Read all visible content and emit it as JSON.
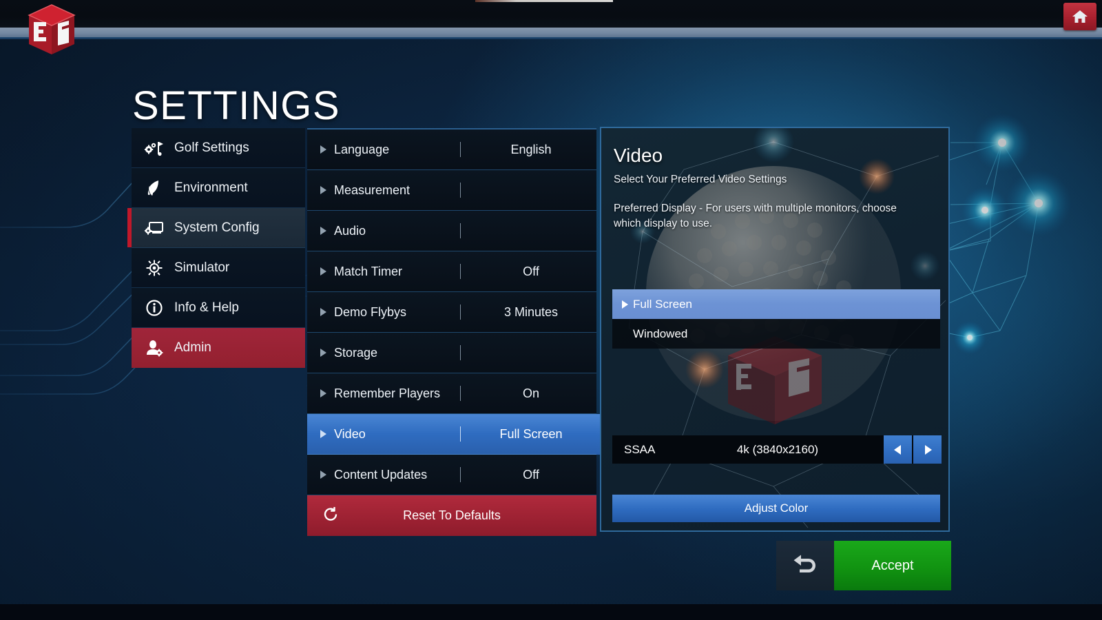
{
  "app": {
    "logo_text": "E6",
    "home_icon": "home-icon"
  },
  "page_title": "SETTINGS",
  "sidebar": {
    "items": [
      {
        "label": "Golf Settings",
        "icon": "golf-flag-gear-icon",
        "state": "normal"
      },
      {
        "label": "Environment",
        "icon": "leaf-icon",
        "state": "normal"
      },
      {
        "label": "System Config",
        "icon": "monitor-gear-icon",
        "state": "selected"
      },
      {
        "label": "Simulator",
        "icon": "crosshair-target-icon",
        "state": "normal"
      },
      {
        "label": "Info & Help",
        "icon": "info-circle-icon",
        "state": "normal"
      },
      {
        "label": "Admin",
        "icon": "user-gear-icon",
        "state": "highlighted"
      }
    ]
  },
  "settings_list": {
    "rows": [
      {
        "label": "Language",
        "value": "English",
        "selected": false
      },
      {
        "label": "Measurement",
        "value": "",
        "selected": false
      },
      {
        "label": "Audio",
        "value": "",
        "selected": false
      },
      {
        "label": "Match Timer",
        "value": "Off",
        "selected": false
      },
      {
        "label": "Demo Flybys",
        "value": "3 Minutes",
        "selected": false
      },
      {
        "label": "Storage",
        "value": "",
        "selected": false
      },
      {
        "label": "Remember Players",
        "value": "On",
        "selected": false
      },
      {
        "label": "Video",
        "value": "Full Screen",
        "selected": true
      },
      {
        "label": "Content Updates",
        "value": "Off",
        "selected": false
      }
    ],
    "reset": {
      "label": "Reset To Defaults",
      "icon": "refresh-icon"
    }
  },
  "detail_panel": {
    "title": "Video",
    "subtitle": "Select Your Preferred Video Settings",
    "description": "Preferred Display - For users with multiple monitors, choose which display to use.",
    "options": [
      {
        "label": "Full Screen",
        "selected": true
      },
      {
        "label": "Windowed",
        "selected": false
      }
    ],
    "ssaa": {
      "label": "SSAA",
      "value": "4k (3840x2160)",
      "prev_icon": "triangle-left-icon",
      "next_icon": "triangle-right-icon"
    },
    "adjust_color_label": "Adjust Color"
  },
  "footer": {
    "back_icon": "undo-arrow-icon",
    "accept_label": "Accept"
  },
  "colors": {
    "accent_red": "#9e2233",
    "accent_blue": "#2f6cc0",
    "option_highlight": "#6c92d4",
    "accept_green": "#119311",
    "panel_border": "#2f6a9c"
  }
}
